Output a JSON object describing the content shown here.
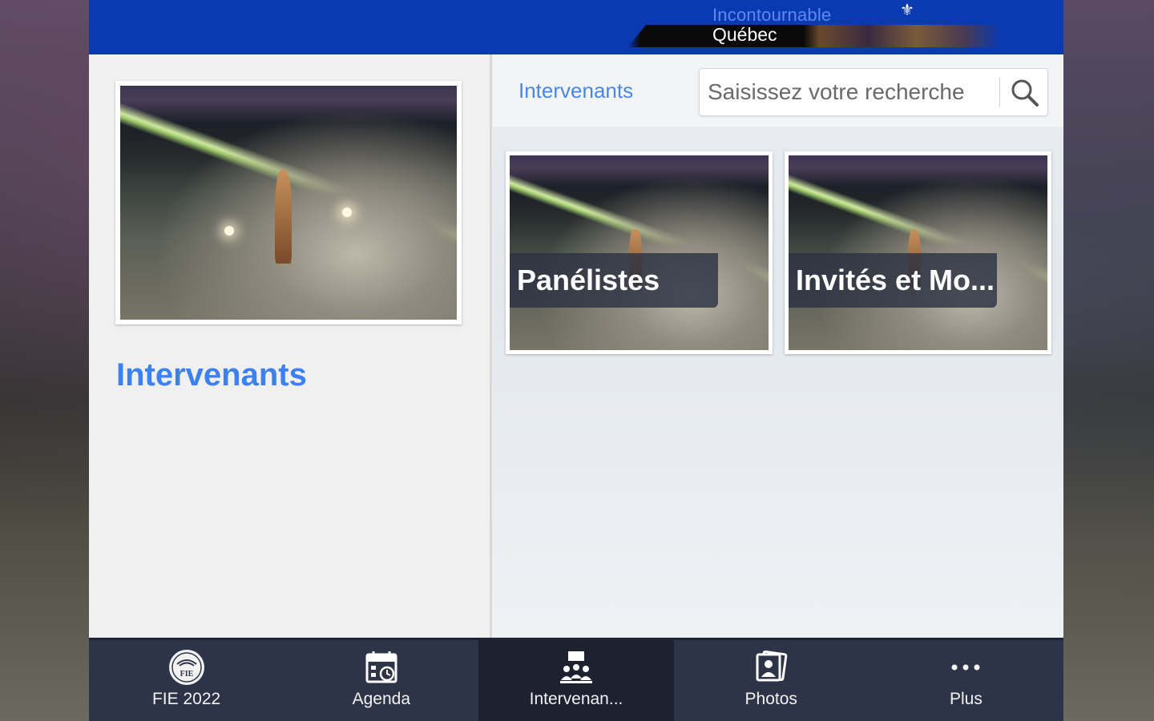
{
  "header": {
    "logo_line1": "Incontournable",
    "logo_line2": "Québec"
  },
  "left_panel": {
    "title": "Intervenants"
  },
  "right_panel": {
    "title": "Intervenants",
    "search": {
      "placeholder": "Saisissez votre recherche",
      "value": ""
    },
    "cards": [
      {
        "label": "Panélistes"
      },
      {
        "label": "Invités et Mo..."
      }
    ]
  },
  "bottom_nav": {
    "items": [
      {
        "label": "FIE 2022",
        "icon": "fie-logo-icon"
      },
      {
        "label": "Agenda",
        "icon": "calendar-icon"
      },
      {
        "label": "Intervenan...",
        "icon": "speakers-icon",
        "active": true
      },
      {
        "label": "Photos",
        "icon": "photos-icon"
      },
      {
        "label": "Plus",
        "icon": "more-dots-icon"
      }
    ]
  },
  "colors": {
    "topbar": "#0a3ab2",
    "accent": "#3b82f0",
    "nav_bg": "#2e3447",
    "nav_active": "#1d2130"
  }
}
